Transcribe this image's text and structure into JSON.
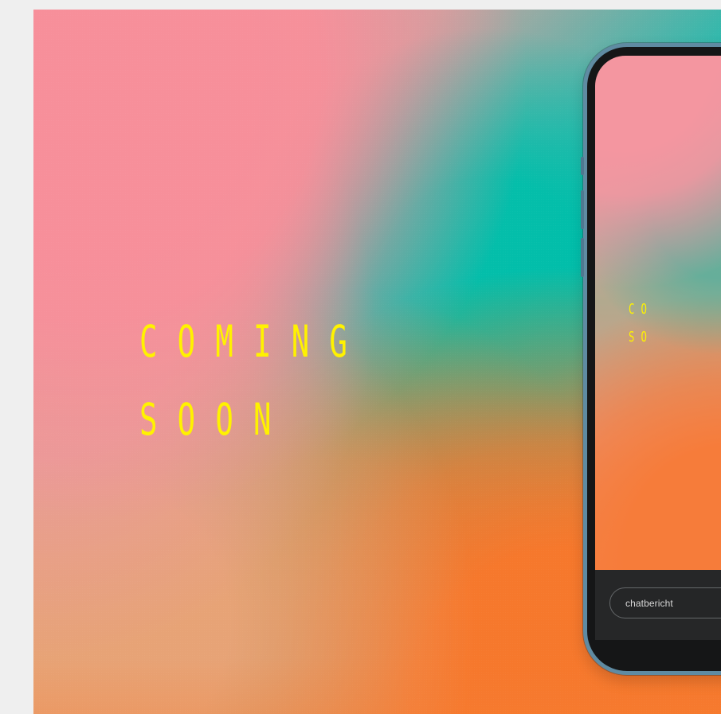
{
  "hero": {
    "line1": "COMING",
    "line2": "SOON"
  },
  "phone": {
    "mini_line1": "CO",
    "mini_line2": "SO",
    "chat_placeholder": "chatbericht"
  },
  "colors": {
    "accent_yellow": "#fff200",
    "pink": "#f396a0",
    "teal": "#14bcae",
    "orange": "#f6782c",
    "phone_frame": "#5f8ba2"
  }
}
